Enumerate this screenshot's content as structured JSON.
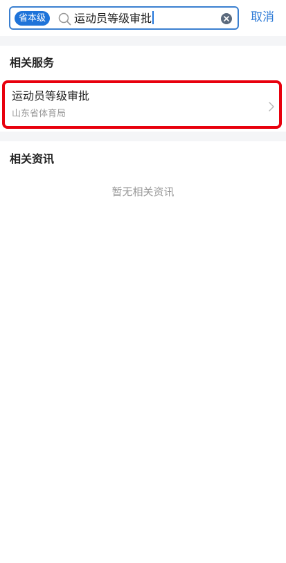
{
  "search": {
    "scope_label": "省本级",
    "query": "运动员等级审批",
    "cancel_label": "取消"
  },
  "related_services": {
    "title": "相关服务",
    "items": [
      {
        "name": "运动员等级审批",
        "department": "山东省体育局"
      }
    ]
  },
  "related_news": {
    "title": "相关资讯",
    "empty_text": "暂无相关资讯"
  },
  "colors": {
    "accent": "#1e73d9",
    "highlight_border": "#e8000d"
  },
  "icons": {
    "search": "search-icon",
    "clear": "clear-icon",
    "chevron": "chevron-right-icon"
  }
}
